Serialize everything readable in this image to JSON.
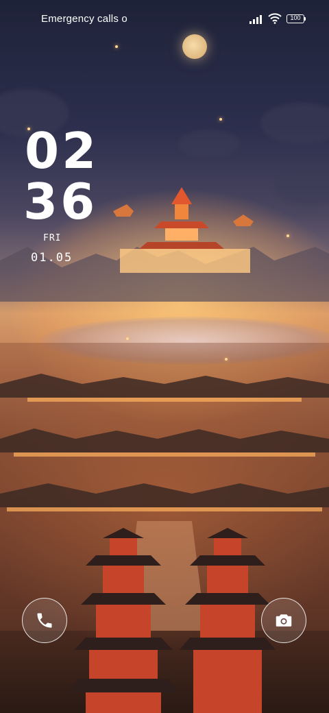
{
  "status_bar": {
    "carrier_text": "Emergency calls o",
    "signal_icon": "signal-icon",
    "wifi_icon": "wifi-icon",
    "battery_level": "100"
  },
  "clock": {
    "hours": "02",
    "minutes": "36",
    "day": "FRI",
    "date": "01.05"
  },
  "shortcuts": {
    "left_icon": "phone-icon",
    "right_icon": "camera-icon"
  },
  "colors": {
    "sky_top": "#1e2238",
    "horizon_glow": "#d59b6a",
    "city_light": "#ffb25e"
  }
}
